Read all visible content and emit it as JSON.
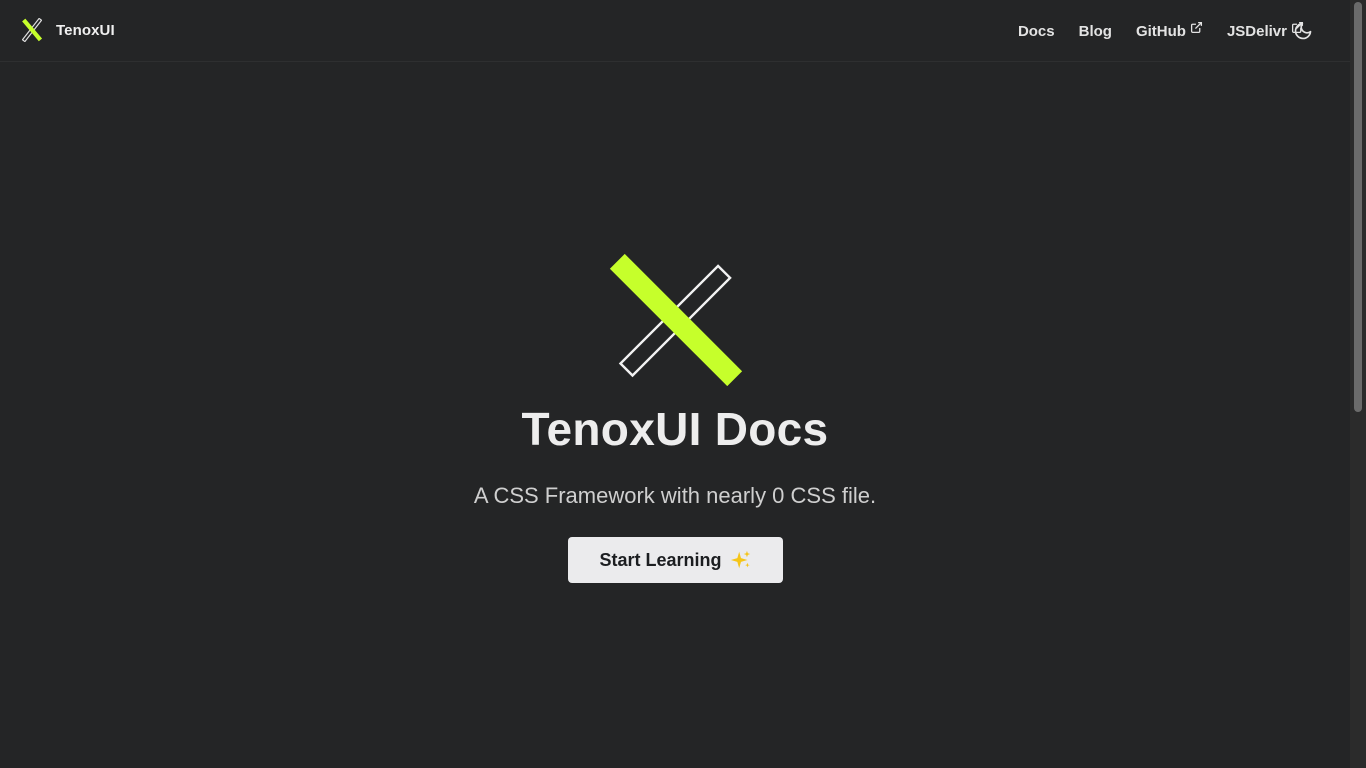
{
  "navbar": {
    "brand_name": "TenoxUI",
    "links": [
      {
        "label": "Docs",
        "icon": ""
      },
      {
        "label": "Blog",
        "icon": ""
      },
      {
        "label": "GitHub",
        "icon": "external-link-icon"
      },
      {
        "label": "JSDelivr",
        "icon": "external-link-icon"
      }
    ],
    "theme_toggle_icon": "moon-icon"
  },
  "hero": {
    "title": "TenoxUI Docs",
    "subtitle": "A CSS Framework with nearly 0 CSS file.",
    "cta_label": "Start Learning",
    "cta_icon": "sparkles-icon"
  },
  "colors": {
    "background": "#242526",
    "accent": "#c6ff2b",
    "text": "#e3e3e3",
    "button_bg": "#ebebed",
    "button_text": "#1c1e21"
  }
}
